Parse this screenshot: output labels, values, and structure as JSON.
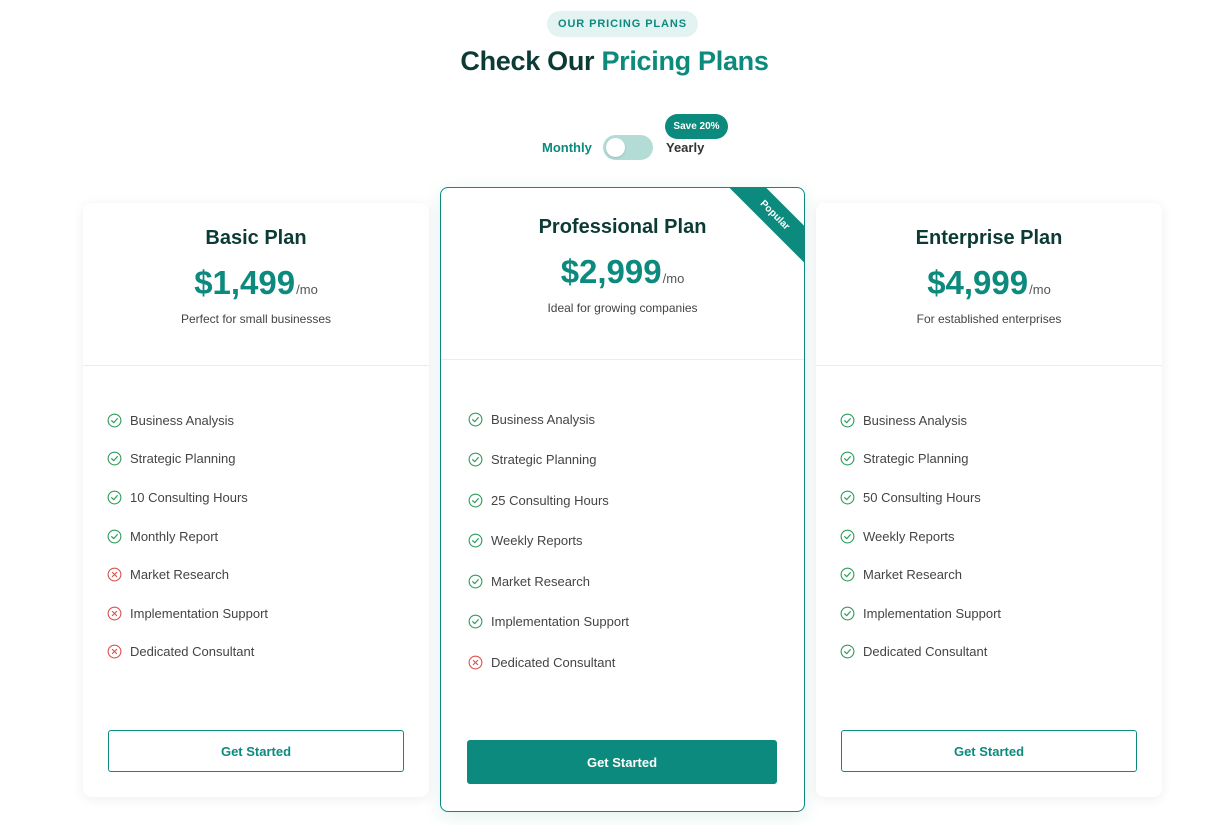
{
  "header": {
    "eyebrow": "OUR PRICING PLANS",
    "title_prefix": "Check Our",
    "title_accent": "Pricing Plans"
  },
  "billing_toggle": {
    "monthly_label": "Monthly",
    "yearly_label": "Yearly",
    "save_badge": "Save 20%",
    "selected": "Monthly"
  },
  "colors": {
    "brand": "#0b8a7d",
    "heading": "#0c3b36",
    "check": "#2e9d5c",
    "cross": "#d9534f"
  },
  "plans": [
    {
      "name": "Basic Plan",
      "price": "$1,499",
      "period": "/mo",
      "description": "Perfect for small businesses",
      "features": [
        {
          "label": "Business Analysis",
          "included": true
        },
        {
          "label": "Strategic Planning",
          "included": true
        },
        {
          "label": "10 Consulting Hours",
          "included": true
        },
        {
          "label": "Monthly Report",
          "included": true
        },
        {
          "label": "Market Research",
          "included": false
        },
        {
          "label": "Implementation Support",
          "included": false
        },
        {
          "label": "Dedicated Consultant",
          "included": false
        }
      ],
      "cta": "Get Started"
    },
    {
      "name": "Professional Plan",
      "price": "$2,999",
      "period": "/mo",
      "description": "Ideal for growing companies",
      "ribbon": "Popular",
      "features": [
        {
          "label": "Business Analysis",
          "included": true
        },
        {
          "label": "Strategic Planning",
          "included": true
        },
        {
          "label": "25 Consulting Hours",
          "included": true
        },
        {
          "label": "Weekly Reports",
          "included": true
        },
        {
          "label": "Market Research",
          "included": true
        },
        {
          "label": "Implementation Support",
          "included": true
        },
        {
          "label": "Dedicated Consultant",
          "included": false
        }
      ],
      "cta": "Get Started"
    },
    {
      "name": "Enterprise Plan",
      "price": "$4,999",
      "period": "/mo",
      "description": "For established enterprises",
      "features": [
        {
          "label": "Business Analysis",
          "included": true
        },
        {
          "label": "Strategic Planning",
          "included": true
        },
        {
          "label": "50 Consulting Hours",
          "included": true
        },
        {
          "label": "Weekly Reports",
          "included": true
        },
        {
          "label": "Market Research",
          "included": true
        },
        {
          "label": "Implementation Support",
          "included": true
        },
        {
          "label": "Dedicated Consultant",
          "included": true
        }
      ],
      "cta": "Get Started"
    }
  ]
}
